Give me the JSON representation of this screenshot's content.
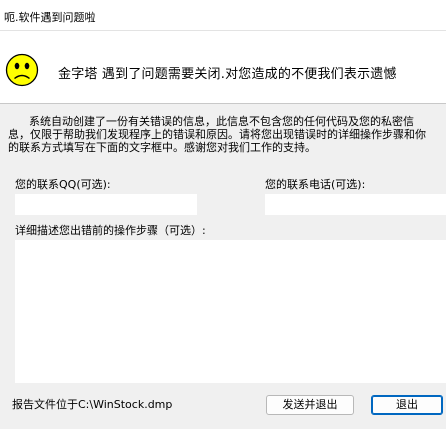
{
  "window": {
    "title": "呃.软件遇到问题啦"
  },
  "header": {
    "headline": "金字塔  遇到了问题需要关闭.对您造成的不便我们表示遗憾"
  },
  "description": "      系统自动创建了一份有关错误的信息，此信息不包含您的任何代码及您的私密信息，仅限于帮助我们发现程序上的错误和原因。请将您出现错误时的详细操作步骤和你的联系方式填写在下面的文字框中。感谢您对我们工作的支持。",
  "form": {
    "qq_label": "您的联系QQ(可选):",
    "qq_value": "",
    "phone_label": "您的联系电话(可选):",
    "phone_value": "",
    "steps_label": "详细描述您出错前的操作步骤（可选）:",
    "steps_value": ""
  },
  "footer": {
    "report_path": "报告文件位于C:\\WinStock.dmp",
    "send_exit_label": "发送并退出",
    "exit_label": "退出"
  },
  "icons": {
    "header_icon": "sad-face-icon"
  },
  "colors": {
    "face_yellow": "#ffff00",
    "button_accent": "#0067c0"
  }
}
